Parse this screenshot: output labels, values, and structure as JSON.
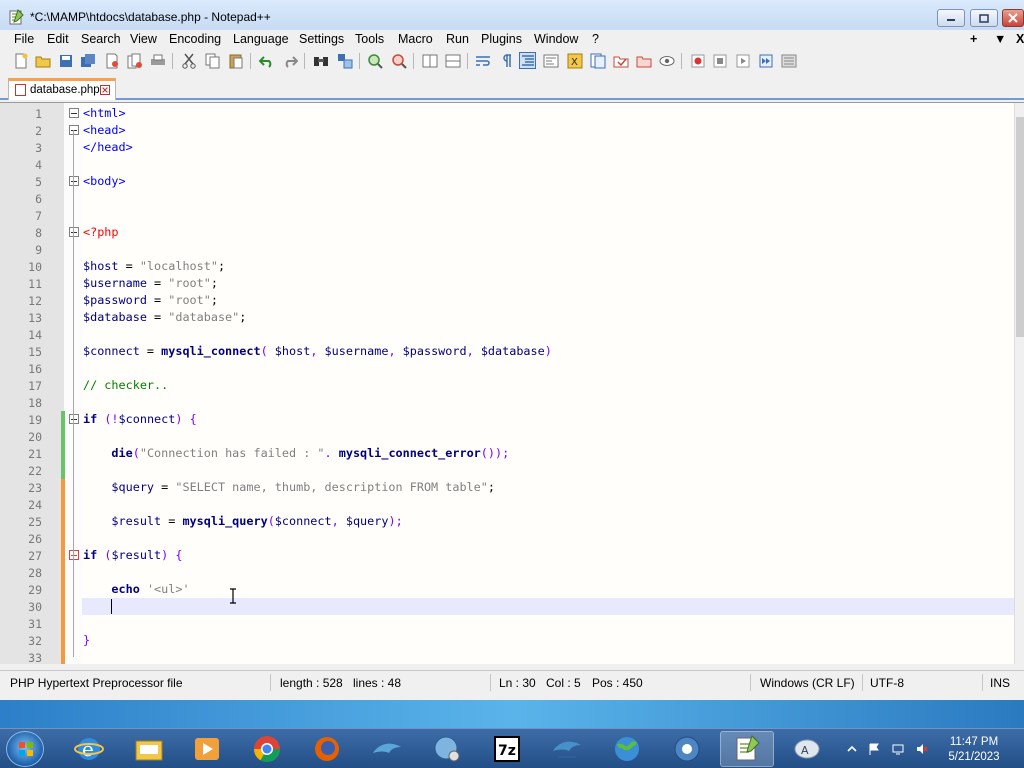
{
  "window": {
    "title": "*C:\\MAMP\\htdocs\\database.php - Notepad++"
  },
  "menu": [
    "File",
    "Edit",
    "Search",
    "View",
    "Encoding",
    "Language",
    "Settings",
    "Tools",
    "Macro",
    "Run",
    "Plugins",
    "Window",
    "?"
  ],
  "menu_right": [
    "+",
    "▼",
    "X"
  ],
  "tab": {
    "label": "database.php"
  },
  "editor": {
    "lines": [
      {
        "n": "1",
        "segments": [
          [
            "tag",
            "<html>"
          ]
        ],
        "fold": "box"
      },
      {
        "n": "2",
        "segments": [
          [
            "tag",
            "<head>"
          ]
        ],
        "fold": "box"
      },
      {
        "n": "3",
        "segments": [
          [
            "tag",
            "</head>"
          ]
        ],
        "fold": "end"
      },
      {
        "n": "4",
        "segments": [],
        "fold": "line"
      },
      {
        "n": "5",
        "segments": [
          [
            "tag",
            "<body>"
          ]
        ],
        "fold": "box"
      },
      {
        "n": "6",
        "segments": [],
        "fold": "line"
      },
      {
        "n": "7",
        "segments": [],
        "fold": "line"
      },
      {
        "n": "8",
        "segments": [
          [
            "php",
            "<?php"
          ]
        ],
        "fold": "box"
      },
      {
        "n": "9",
        "segments": [],
        "fold": "line"
      },
      {
        "n": "10",
        "segments": [
          [
            "var",
            "$host"
          ],
          [
            "plain",
            " = "
          ],
          [
            "str",
            "\"localhost\""
          ],
          [
            "plain",
            ";"
          ]
        ],
        "fold": "line"
      },
      {
        "n": "11",
        "segments": [
          [
            "var",
            "$username"
          ],
          [
            "plain",
            " = "
          ],
          [
            "str",
            "\"root\""
          ],
          [
            "plain",
            ";"
          ]
        ],
        "fold": "line"
      },
      {
        "n": "12",
        "segments": [
          [
            "var",
            "$password"
          ],
          [
            "plain",
            " = "
          ],
          [
            "str",
            "\"root\""
          ],
          [
            "plain",
            ";"
          ]
        ],
        "fold": "line"
      },
      {
        "n": "13",
        "segments": [
          [
            "var",
            "$database"
          ],
          [
            "plain",
            " = "
          ],
          [
            "str",
            "\"database\""
          ],
          [
            "plain",
            ";"
          ]
        ],
        "fold": "line"
      },
      {
        "n": "14",
        "segments": [],
        "fold": "line"
      },
      {
        "n": "15",
        "segments": [
          [
            "var",
            "$connect"
          ],
          [
            "plain",
            " = "
          ],
          [
            "fn",
            "mysqli_connect"
          ],
          [
            "op",
            "( "
          ],
          [
            "var",
            "$host"
          ],
          [
            "op",
            ", "
          ],
          [
            "var",
            "$username"
          ],
          [
            "op",
            ", "
          ],
          [
            "var",
            "$password"
          ],
          [
            "op",
            ", "
          ],
          [
            "var",
            "$database"
          ],
          [
            "op",
            ")"
          ]
        ],
        "fold": "line"
      },
      {
        "n": "16",
        "segments": [],
        "fold": "line"
      },
      {
        "n": "17",
        "segments": [
          [
            "cmt",
            "// checker.."
          ]
        ],
        "fold": "line"
      },
      {
        "n": "18",
        "segments": [],
        "fold": "line"
      },
      {
        "n": "19",
        "segments": [
          [
            "kw",
            "if"
          ],
          [
            "op",
            " (!"
          ],
          [
            "var",
            "$connect"
          ],
          [
            "op",
            ") {"
          ]
        ],
        "fold": "box"
      },
      {
        "n": "20",
        "segments": [],
        "fold": "line"
      },
      {
        "n": "21",
        "segments": [
          [
            "plain",
            "    "
          ],
          [
            "kw",
            "die"
          ],
          [
            "op",
            "("
          ],
          [
            "str",
            "\"Connection has failed : \""
          ],
          [
            "op",
            ". "
          ],
          [
            "fn",
            "mysqli_connect_error"
          ],
          [
            "op",
            "());"
          ]
        ],
        "fold": "line"
      },
      {
        "n": "22",
        "segments": [],
        "fold": "line"
      },
      {
        "n": "23",
        "segments": [
          [
            "plain",
            "    "
          ],
          [
            "var",
            "$query"
          ],
          [
            "plain",
            " = "
          ],
          [
            "str",
            "\"SELECT name, thumb, description FROM table\""
          ],
          [
            "plain",
            ";"
          ]
        ],
        "fold": "line"
      },
      {
        "n": "24",
        "segments": [],
        "fold": "line"
      },
      {
        "n": "25",
        "segments": [
          [
            "plain",
            "    "
          ],
          [
            "var",
            "$result"
          ],
          [
            "plain",
            " = "
          ],
          [
            "fn",
            "mysqli_query"
          ],
          [
            "op",
            "("
          ],
          [
            "var",
            "$connect"
          ],
          [
            "op",
            ", "
          ],
          [
            "var",
            "$query"
          ],
          [
            "op",
            ");"
          ]
        ],
        "fold": "line"
      },
      {
        "n": "26",
        "segments": [],
        "fold": "line"
      },
      {
        "n": "27",
        "segments": [
          [
            "kw",
            "if"
          ],
          [
            "op",
            " ("
          ],
          [
            "var",
            "$result"
          ],
          [
            "op",
            ") {"
          ]
        ],
        "fold": "boxred"
      },
      {
        "n": "28",
        "segments": [],
        "fold": "line"
      },
      {
        "n": "29",
        "segments": [
          [
            "plain",
            "    "
          ],
          [
            "kw",
            "echo"
          ],
          [
            "plain",
            " "
          ],
          [
            "str",
            "'<ul>'"
          ]
        ],
        "fold": "line"
      },
      {
        "n": "30",
        "segments": [],
        "fold": "line",
        "current": true
      },
      {
        "n": "31",
        "segments": [],
        "fold": "line"
      },
      {
        "n": "32",
        "segments": [
          [
            "op",
            "}"
          ]
        ],
        "fold": "end"
      },
      {
        "n": "33",
        "segments": [],
        "fold": "line"
      }
    ]
  },
  "status": {
    "filetype": "PHP Hypertext Preprocessor file",
    "length": "length : 528",
    "lines": "lines : 48",
    "ln": "Ln : 30",
    "col": "Col : 5",
    "pos": "Pos : 450",
    "eol": "Windows (CR LF)",
    "encoding": "UTF-8",
    "mode": "INS"
  },
  "taskbar": {
    "time": "11:47 PM",
    "date": "5/21/2023",
    "sevenzip_label": "7z"
  },
  "colors": {
    "keyword": "#000080",
    "string": "#808080",
    "tag": "#0000ff",
    "php": "#ff0000",
    "comment": "#008000",
    "tab_accent": "#f7a24b"
  }
}
